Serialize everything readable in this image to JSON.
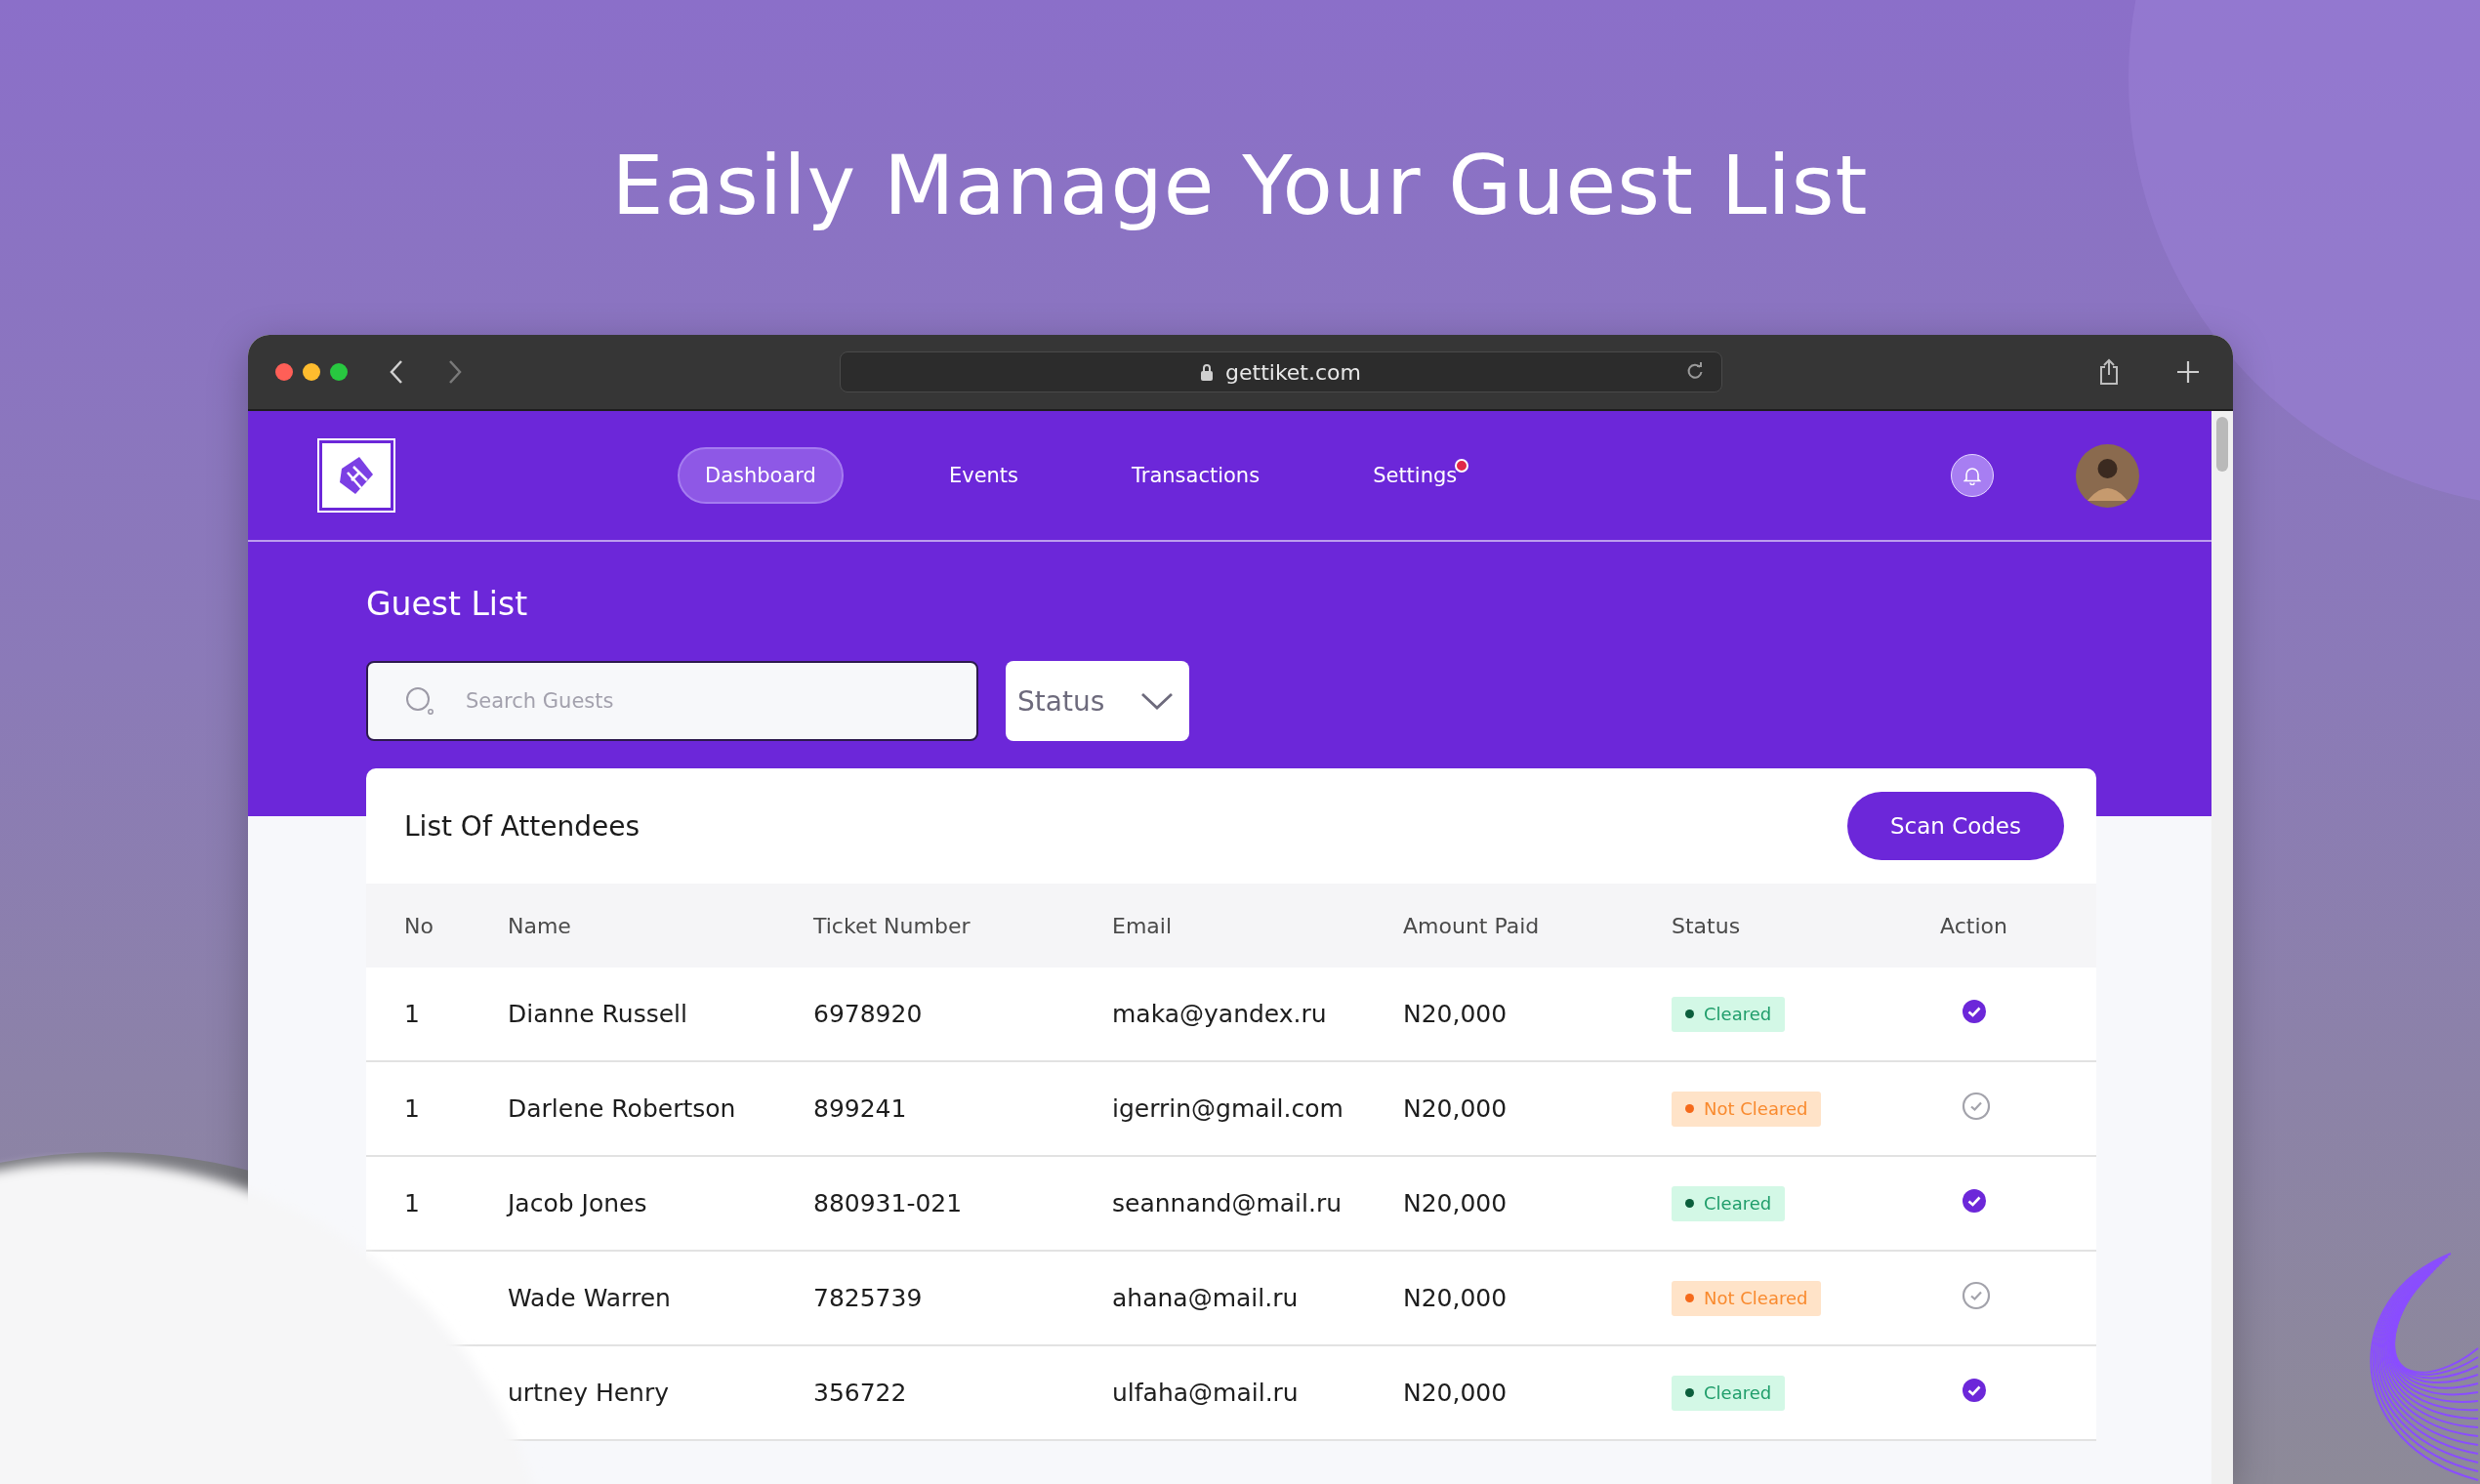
{
  "headline": "Easily Manage Your Guest List",
  "browser": {
    "url": "gettiket.com"
  },
  "nav": {
    "items": [
      {
        "label": "Dashboard",
        "selected": true,
        "notification": false
      },
      {
        "label": "Events",
        "selected": false,
        "notification": false
      },
      {
        "label": "Transactions",
        "selected": false,
        "notification": false
      },
      {
        "label": "Settings",
        "selected": false,
        "notification": true
      }
    ]
  },
  "page": {
    "title": "Guest List",
    "search": {
      "placeholder": "Search Guests"
    },
    "status_filter": {
      "value": "Status"
    }
  },
  "table": {
    "title": "List Of Attendees",
    "action_button": "Scan Codes",
    "columns": [
      "No",
      "Name",
      "Ticket Number",
      "Email",
      "Amount Paid",
      "Status",
      "Action"
    ],
    "rows": [
      {
        "no": "1",
        "name": "Dianne Russell",
        "ticket": "6978920",
        "email": "maka@yandex.ru",
        "amount": "N20,000",
        "status": {
          "label": "Cleared",
          "kind": "cleared"
        },
        "checked": true
      },
      {
        "no": "1",
        "name": "Darlene Robertson",
        "ticket": "899241",
        "email": "igerrin@gmail.com",
        "amount": "N20,000",
        "status": {
          "label": "Not Cleared",
          "kind": "not_cleared"
        },
        "checked": false
      },
      {
        "no": "1",
        "name": "Jacob Jones",
        "ticket": "880931-021",
        "email": "seannand@mail.ru",
        "amount": "N20,000",
        "status": {
          "label": "Cleared",
          "kind": "cleared"
        },
        "checked": true
      },
      {
        "name": "Wade Warren",
        "ticket": "7825739",
        "email": "ahana@mail.ru",
        "amount": "N20,000",
        "status": {
          "label": "Not Cleared",
          "kind": "not_cleared"
        },
        "checked": false
      },
      {
        "name": "urtney Henry",
        "ticket": "356722",
        "email": "ulfaha@mail.ru",
        "amount": "N20,000",
        "status": {
          "label": "Cleared",
          "kind": "cleared"
        },
        "checked": true
      }
    ]
  }
}
